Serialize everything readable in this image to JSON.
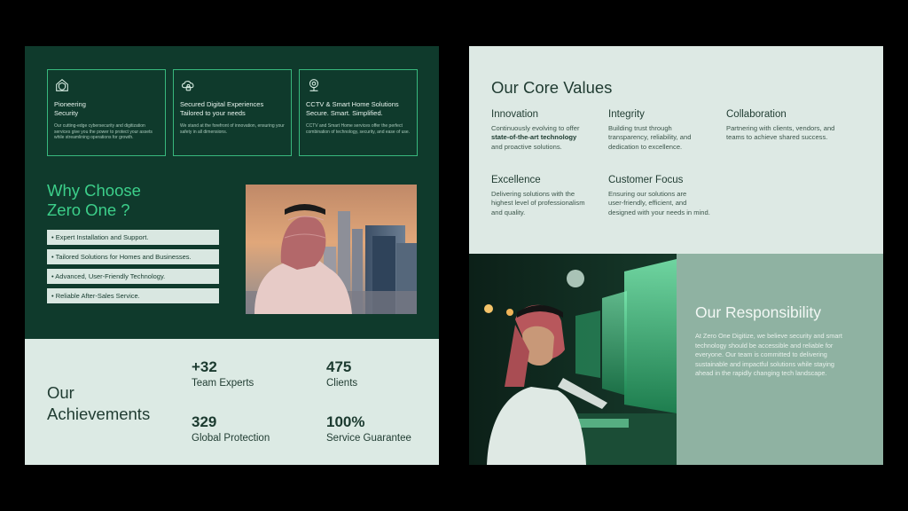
{
  "left_page": {
    "cards": [
      {
        "icon": "shield-house-icon",
        "title_line1": "Pioneering",
        "title_line2": "Security",
        "desc": "Our cutting-edge cybersecurity and digitization services give you the power to protect your assets while streamlining operations for growth."
      },
      {
        "icon": "cloud-lock-icon",
        "title_line1": "Secured Digital Experiences",
        "title_line2": "Tailored to your needs",
        "desc": "We stand at the forefront of innovation, ensuring your safety in all dimensions."
      },
      {
        "icon": "camera-icon",
        "title_line1": "CCTV & Smart Home Solutions",
        "title_line2": "Secure. Smart. Simplified.",
        "desc": "CCTV and Smart Home services offer the perfect combination of technology, security, and ease of use."
      }
    ],
    "why": {
      "title_line1": "Why Choose",
      "title_line2": "Zero One ?",
      "items": [
        "• Expert Installation and Support.",
        "• Tailored Solutions for Homes and Businesses.",
        "• Advanced, User-Friendly Technology.",
        "• Reliable After-Sales Service."
      ]
    },
    "achievements": {
      "title_line1": "Our",
      "title_line2": "Achievements",
      "stats": [
        {
          "value": "+32",
          "label": "Team Experts"
        },
        {
          "value": "475",
          "label": "Clients"
        },
        {
          "value": "329",
          "label": "Global Protection"
        },
        {
          "value": "100%",
          "label": "Service Guarantee"
        }
      ]
    }
  },
  "right_page": {
    "values_title": "Our Core Values",
    "values": [
      {
        "title": "Innovation",
        "line1": "Continuously evolving to offer",
        "bold": "state-of-the-art technology",
        "line3": "and proactive solutions."
      },
      {
        "title": "Integrity",
        "line1": "Building trust through",
        "line2": "transparency, reliability, and",
        "line3": "dedication to excellence."
      },
      {
        "title": "Collaboration",
        "line1": "Partnering with clients, vendors, and",
        "line2": "teams to achieve shared success."
      },
      {
        "title": "Excellence",
        "line1": "Delivering solutions with the",
        "line2": "highest level of professionalism",
        "line3": "and quality."
      },
      {
        "title": "Customer Focus",
        "line1": "Ensuring our solutions are",
        "line2": "user-friendly, efficient, and",
        "line3": "designed with your needs in mind."
      }
    ],
    "responsibility": {
      "title": "Our Responsibility",
      "text": "At Zero One Digitize, we believe security and smart technology should be accessible and reliable for everyone. Our team is committed to delivering sustainable and impactful solutions while staying ahead in the rapidly changing tech landscape."
    }
  },
  "colors": {
    "dark_green": "#0f3a2c",
    "accent_green": "#3ccf8a",
    "light_panel": "#dceae4",
    "sage": "#8fb2a2"
  }
}
